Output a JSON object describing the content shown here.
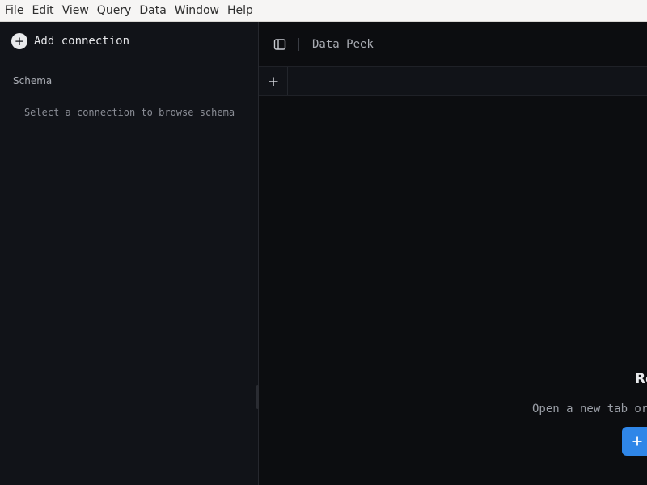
{
  "menubar": {
    "items": [
      "File",
      "Edit",
      "View",
      "Query",
      "Data",
      "Window",
      "Help"
    ]
  },
  "sidebar": {
    "add_connection_label": "Add connection",
    "schema_title": "Schema",
    "schema_empty": "Select a connection to browse schema"
  },
  "header": {
    "app_title": "Data Peek"
  },
  "tabs": {
    "new_tab_symbol": "+"
  },
  "empty_state": {
    "title": "Re",
    "subtitle": "Open a new tab or",
    "button_symbol": "+"
  },
  "colors": {
    "accent": "#2f86e8",
    "background": "#0c0d10",
    "sidebar": "#111318"
  },
  "icons": [
    "plus-circle-icon",
    "sidebar-toggle-icon",
    "plus-icon"
  ]
}
